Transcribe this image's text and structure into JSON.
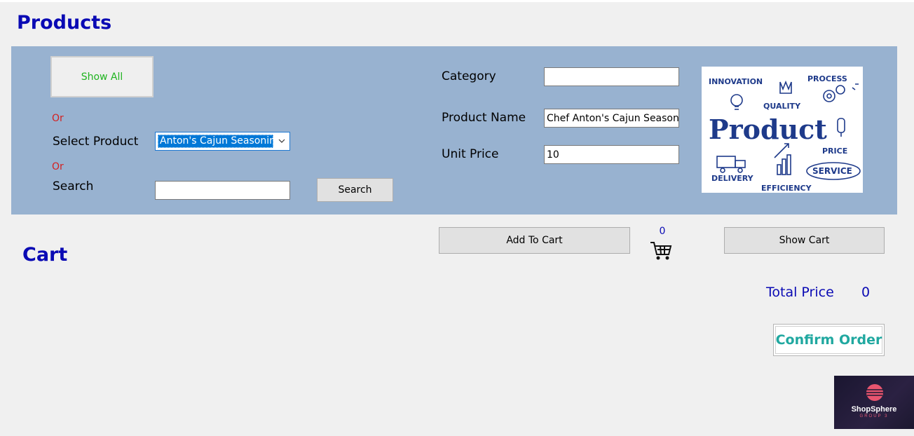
{
  "products_section": {
    "title": "Products"
  },
  "filters": {
    "show_all_label": "Show All",
    "or_label_1": "Or",
    "select_product_label": "Select Product",
    "selected_product": "Anton's Cajun Seasoning",
    "or_label_2": "Or",
    "search_label": "Search",
    "search_value": "",
    "search_button_label": "Search"
  },
  "details": {
    "category_label": "Category",
    "category_value": "",
    "product_name_label": "Product Name",
    "product_name_value": "Chef Anton's Cajun Seasonin",
    "unit_price_label": "Unit Price",
    "unit_price_value": "10"
  },
  "product_image": {
    "words": {
      "innovation": "INNOVATION",
      "process": "PROCESS",
      "quality": "QUALITY",
      "product": "Product",
      "price": "PRICE",
      "delivery": "DELIVERY",
      "efficiency": "EFFICIENCY",
      "service": "SERVICE"
    }
  },
  "cart_actions": {
    "add_to_cart_label": "Add To Cart",
    "cart_count": "0",
    "show_cart_label": "Show Cart"
  },
  "cart_section": {
    "title": "Cart",
    "total_price_label": "Total Price",
    "total_price_value": "0",
    "confirm_order_label": "Confirm Order"
  },
  "branding": {
    "name": "ShopSphere",
    "group": "GROUP 3"
  },
  "colors": {
    "title_blue": "#0a0ab4",
    "panel_bg": "#98b2d0",
    "or_red": "#d42020",
    "show_all_green": "#1fb41f",
    "confirm_teal": "#20a8a0",
    "selection_blue": "#0078d7"
  },
  "icons": {
    "cart": "shopping-cart-icon",
    "dropdown": "chevron-down-icon"
  }
}
